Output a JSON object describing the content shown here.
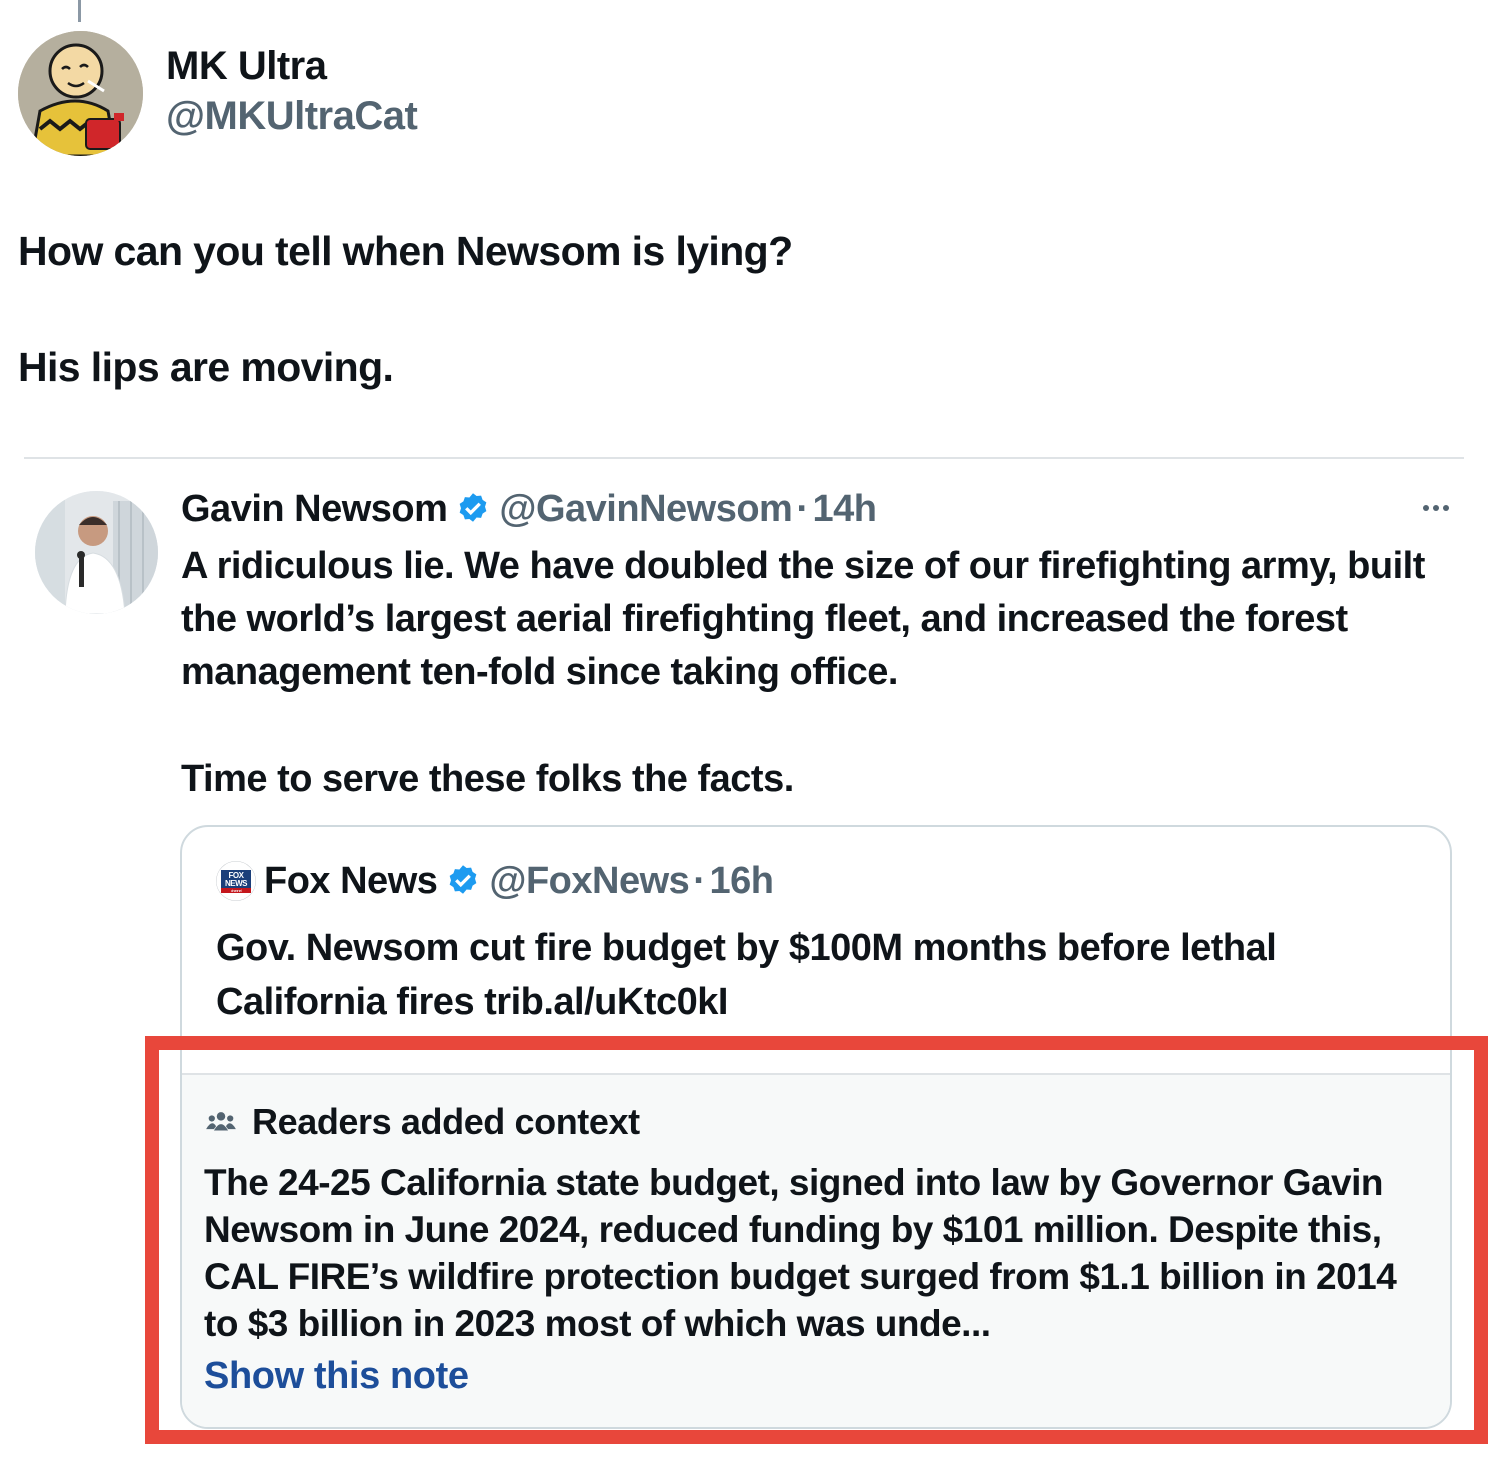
{
  "main_post": {
    "author_name": "MK Ultra",
    "author_handle": "@MKUltraCat",
    "text_line1": "How can you tell when Newsom is lying?",
    "text_line2": "His lips are moving."
  },
  "reply": {
    "author_name": "Gavin Newsom",
    "author_handle": "@GavinNewsom",
    "separator": "·",
    "time": "14h",
    "paragraph1": "A ridiculous lie. We have doubled the size of our firefighting army, built the world’s largest aerial firefighting fleet, and increased the forest management ten-fold since taking office.",
    "paragraph2": "Time to serve these folks the facts.",
    "more_icon": "more-horizontal-icon"
  },
  "quoted": {
    "author_name": "Fox News",
    "author_handle": "@FoxNews",
    "separator": "·",
    "time": "16h",
    "text": "Gov. Newsom cut fire budget by $100M months before lethal California fires trib.al/uKtc0kI",
    "logo_text_top": "FOX",
    "logo_text_mid": "NEWS",
    "logo_text_bottom": "channel"
  },
  "note": {
    "title": "Readers added context",
    "body": "The 24-25 California state budget, signed into law by Governor Gavin Newsom in June 2024, reduced funding by $101 million. Despite this, CAL FIRE’s wildfire protection budget surged from $1.1 billion in 2014 to $3 billion in 2023 most of which was unde...",
    "link_label": "Show this note"
  },
  "colors": {
    "verified_badge": "#1d9bf0",
    "note_link": "#1d4e9a",
    "highlight": "#e8473b",
    "secondary_text": "#536471"
  }
}
